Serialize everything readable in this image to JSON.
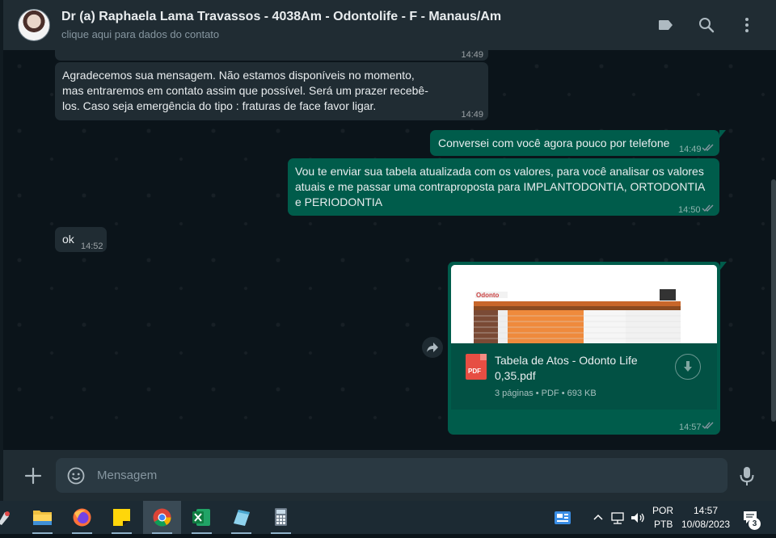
{
  "header": {
    "contact_name": "Dr (a) Raphaela Lama Travassos - 4038Am - Odontolife - F - Manaus/Am",
    "contact_sub": "clique aqui para dados do contato",
    "icons": [
      "label-icon",
      "search-icon",
      "menu-icon"
    ]
  },
  "messages": [
    {
      "direction": "in",
      "text": "",
      "time": "14:49"
    },
    {
      "direction": "in",
      "text": "Agradecemos sua mensagem. Não estamos disponíveis no momento, mas entraremos em contato assim que possível. Será um prazer recebê-los. Caso seja emergência do tipo : fraturas de face favor ligar.",
      "time": "14:49"
    },
    {
      "direction": "out",
      "text": "Conversei com você agora pouco por telefone",
      "time": "14:49",
      "status": "read"
    },
    {
      "direction": "out",
      "text": "Vou te enviar sua tabela atualizada com os valores, para você analisar os valores atuais e me passar uma contraproposta para IMPLANTODONTIA, ORTODONTIA e PERIODONTIA",
      "time": "14:50",
      "status": "read"
    },
    {
      "direction": "in",
      "text": "ok",
      "time": "14:52"
    }
  ],
  "document": {
    "file_type": "PDF",
    "file_name": "Tabela de Atos - Odonto Life 0,35.pdf",
    "meta": "3 páginas • PDF • 693 KB",
    "time": "14:57",
    "status": "read"
  },
  "footer": {
    "placeholder": "Mensagem"
  },
  "taskbar": {
    "apps": [
      "file-explorer",
      "firefox",
      "sticky-notes",
      "chrome",
      "excel",
      "notepad",
      "calculator"
    ],
    "active_app": "chrome",
    "language_line1": "POR",
    "language_line2": "PTB",
    "time": "14:57",
    "date": "10/08/2023",
    "notification_count": "3"
  },
  "colors": {
    "chat_bg": "#0b141a",
    "header_bg": "#202c33",
    "incoming_bubble": "#202c33",
    "outgoing_bubble": "#005c4b",
    "read_ticks": "#8696a0"
  }
}
